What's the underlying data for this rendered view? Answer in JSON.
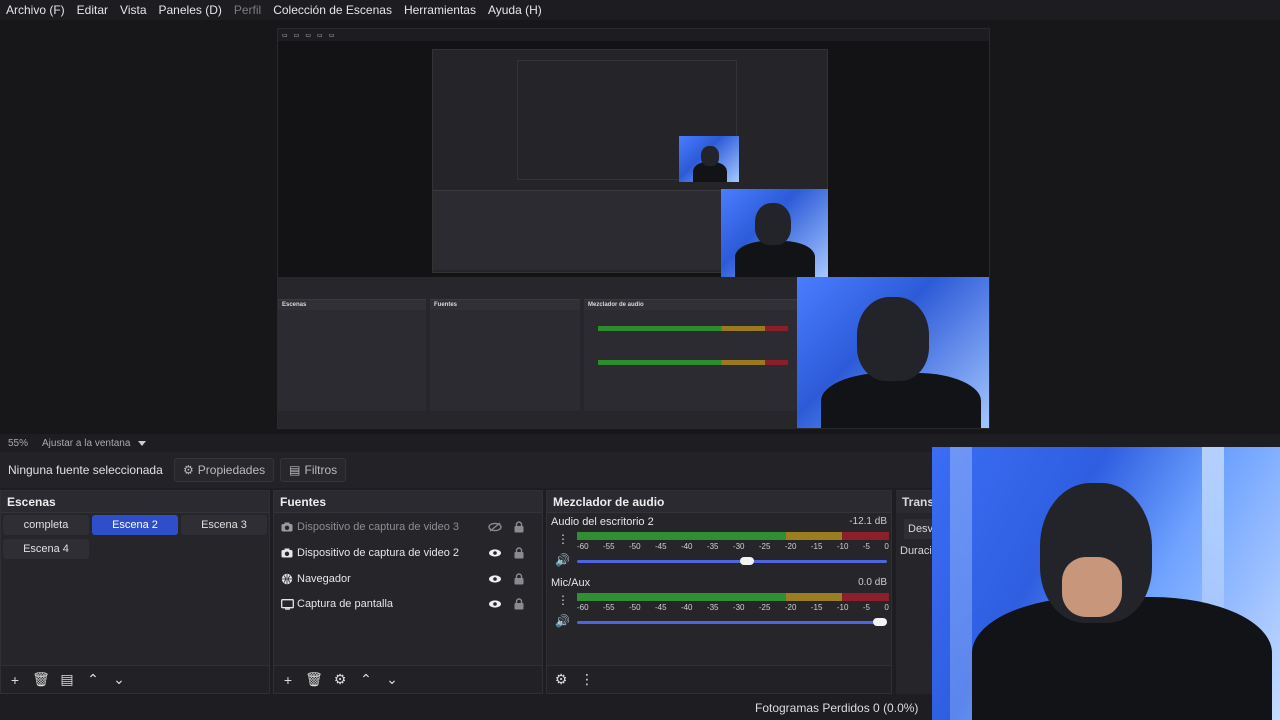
{
  "menu": {
    "items": [
      "Archivo (F)",
      "Editar",
      "Vista",
      "Paneles (D)",
      "Perfil",
      "Colección de Escenas",
      "Herramientas",
      "Ayuda (H)"
    ],
    "disabled": [
      "Perfil"
    ]
  },
  "preview": {
    "zoom": "55%",
    "fit_label": "Ajustar a la ventana"
  },
  "source_toolbar": {
    "no_selection": "Ninguna fuente seleccionada",
    "properties": "Propiedades",
    "filters": "Filtros"
  },
  "scenes": {
    "title": "Escenas",
    "items": [
      "completa",
      "Escena 2",
      "Escena 3",
      "Escena 4"
    ],
    "active": "Escena 2"
  },
  "sources": {
    "title": "Fuentes",
    "items": [
      {
        "label": "Dispositivo de captura de video 3",
        "icon": "camera-icon",
        "visible": false
      },
      {
        "label": "Dispositivo de captura de video 2",
        "icon": "camera-icon",
        "visible": true
      },
      {
        "label": "Navegador",
        "icon": "globe-icon",
        "visible": true
      },
      {
        "label": "Captura de pantalla",
        "icon": "monitor-icon",
        "visible": true
      }
    ]
  },
  "mixer": {
    "title": "Mezclador de audio",
    "tracks": [
      {
        "name": "Audio del escritorio 2",
        "db": "-12.1 dB",
        "level": 0.55
      },
      {
        "name": "Mic/Aux",
        "db": "0.0 dB",
        "level": 1.0
      }
    ],
    "scale": [
      "-60",
      "-55",
      "-50",
      "-45",
      "-40",
      "-35",
      "-30",
      "-25",
      "-20",
      "-15",
      "-10",
      "-5",
      "0"
    ]
  },
  "transitions": {
    "title": "Trans",
    "button": "Desv",
    "duration": "Duració"
  },
  "status": {
    "frames": "Fotogramas Perdidos 0 (0.0%)"
  },
  "colors": {
    "accent": "#2e4fc9",
    "meter_green": "#2f8f32",
    "meter_yellow": "#9b7d22",
    "meter_red": "#8d1e2b"
  }
}
